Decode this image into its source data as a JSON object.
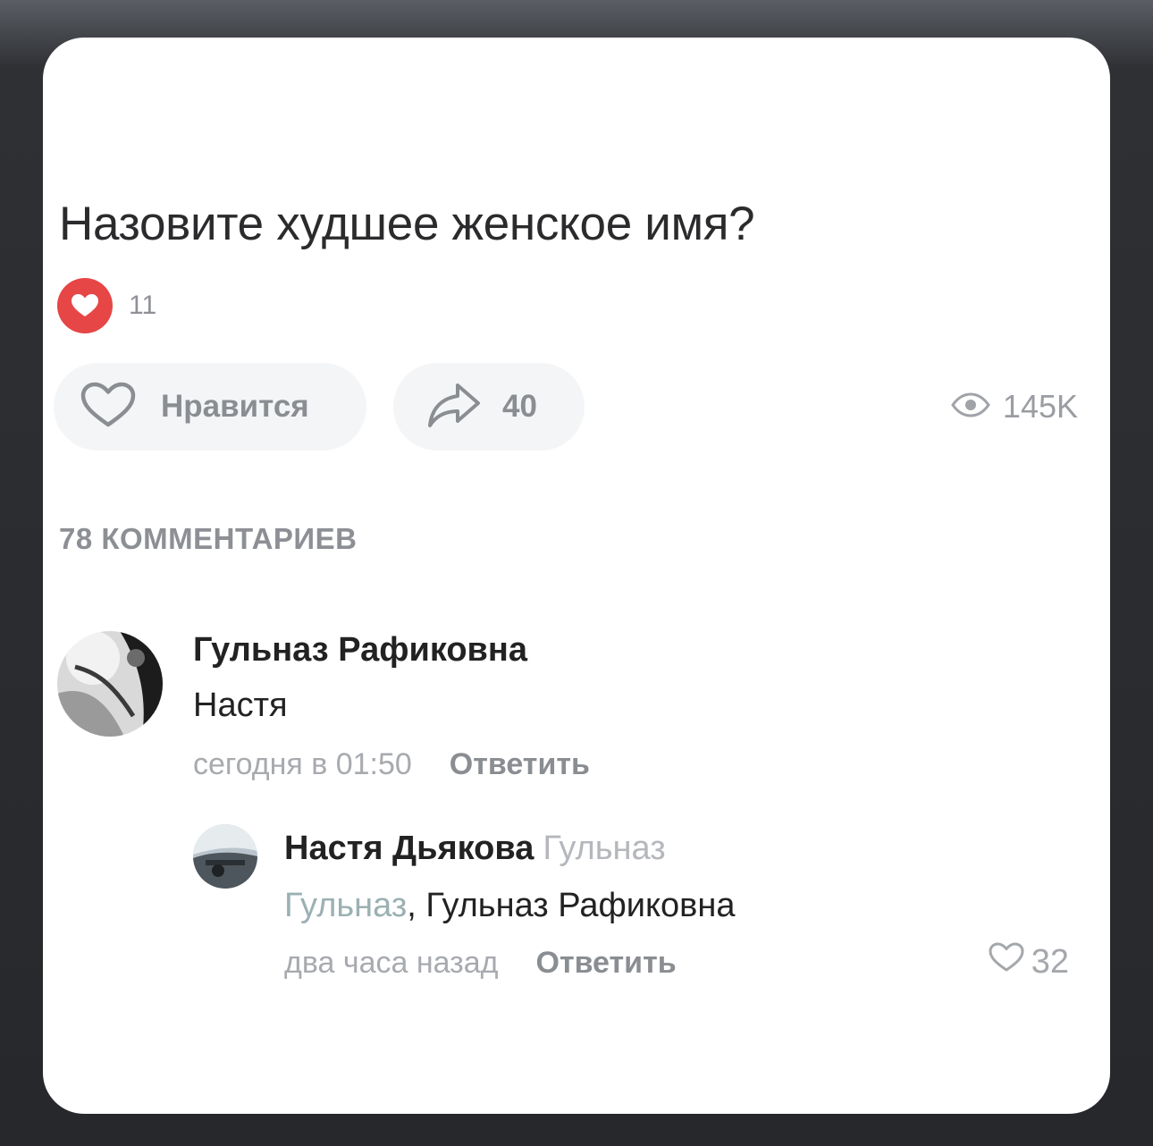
{
  "post": {
    "title": "Назовите худшее женское имя?",
    "reaction_count": "11",
    "like_label": "Нравится",
    "share_count": "40",
    "views": "145K"
  },
  "comments_header": "78 КОММЕНТАРИЕВ",
  "comments": [
    {
      "author": "Гульназ Рафиковна",
      "text": "Настя",
      "time": "сегодня в 01:50",
      "reply_label": "Ответить"
    },
    {
      "author": "Настя Дьякова",
      "reply_to": "Гульназ",
      "mention": "Гульназ",
      "text": ", Гульназ Рафиковна",
      "time": "два часа назад",
      "reply_label": "Ответить",
      "likes": "32"
    }
  ],
  "colors": {
    "reaction_red": "#e64646",
    "button_bg": "#f4f5f6",
    "muted": "#8a8d92"
  }
}
